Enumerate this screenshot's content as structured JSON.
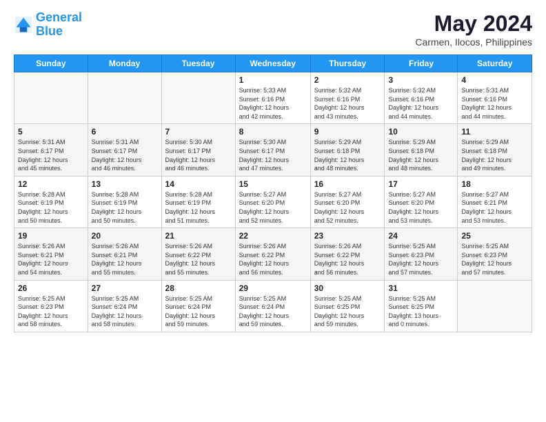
{
  "logo": {
    "line1": "General",
    "line2": "Blue"
  },
  "title": "May 2024",
  "subtitle": "Carmen, Ilocos, Philippines",
  "days_header": [
    "Sunday",
    "Monday",
    "Tuesday",
    "Wednesday",
    "Thursday",
    "Friday",
    "Saturday"
  ],
  "weeks": [
    [
      {
        "day": "",
        "info": ""
      },
      {
        "day": "",
        "info": ""
      },
      {
        "day": "",
        "info": ""
      },
      {
        "day": "1",
        "info": "Sunrise: 5:33 AM\nSunset: 6:16 PM\nDaylight: 12 hours\nand 42 minutes."
      },
      {
        "day": "2",
        "info": "Sunrise: 5:32 AM\nSunset: 6:16 PM\nDaylight: 12 hours\nand 43 minutes."
      },
      {
        "day": "3",
        "info": "Sunrise: 5:32 AM\nSunset: 6:16 PM\nDaylight: 12 hours\nand 44 minutes."
      },
      {
        "day": "4",
        "info": "Sunrise: 5:31 AM\nSunset: 6:16 PM\nDaylight: 12 hours\nand 44 minutes."
      }
    ],
    [
      {
        "day": "5",
        "info": "Sunrise: 5:31 AM\nSunset: 6:17 PM\nDaylight: 12 hours\nand 45 minutes."
      },
      {
        "day": "6",
        "info": "Sunrise: 5:31 AM\nSunset: 6:17 PM\nDaylight: 12 hours\nand 46 minutes."
      },
      {
        "day": "7",
        "info": "Sunrise: 5:30 AM\nSunset: 6:17 PM\nDaylight: 12 hours\nand 46 minutes."
      },
      {
        "day": "8",
        "info": "Sunrise: 5:30 AM\nSunset: 6:17 PM\nDaylight: 12 hours\nand 47 minutes."
      },
      {
        "day": "9",
        "info": "Sunrise: 5:29 AM\nSunset: 6:18 PM\nDaylight: 12 hours\nand 48 minutes."
      },
      {
        "day": "10",
        "info": "Sunrise: 5:29 AM\nSunset: 6:18 PM\nDaylight: 12 hours\nand 48 minutes."
      },
      {
        "day": "11",
        "info": "Sunrise: 5:29 AM\nSunset: 6:18 PM\nDaylight: 12 hours\nand 49 minutes."
      }
    ],
    [
      {
        "day": "12",
        "info": "Sunrise: 5:28 AM\nSunset: 6:19 PM\nDaylight: 12 hours\nand 50 minutes."
      },
      {
        "day": "13",
        "info": "Sunrise: 5:28 AM\nSunset: 6:19 PM\nDaylight: 12 hours\nand 50 minutes."
      },
      {
        "day": "14",
        "info": "Sunrise: 5:28 AM\nSunset: 6:19 PM\nDaylight: 12 hours\nand 51 minutes."
      },
      {
        "day": "15",
        "info": "Sunrise: 5:27 AM\nSunset: 6:20 PM\nDaylight: 12 hours\nand 52 minutes."
      },
      {
        "day": "16",
        "info": "Sunrise: 5:27 AM\nSunset: 6:20 PM\nDaylight: 12 hours\nand 52 minutes."
      },
      {
        "day": "17",
        "info": "Sunrise: 5:27 AM\nSunset: 6:20 PM\nDaylight: 12 hours\nand 53 minutes."
      },
      {
        "day": "18",
        "info": "Sunrise: 5:27 AM\nSunset: 6:21 PM\nDaylight: 12 hours\nand 53 minutes."
      }
    ],
    [
      {
        "day": "19",
        "info": "Sunrise: 5:26 AM\nSunset: 6:21 PM\nDaylight: 12 hours\nand 54 minutes."
      },
      {
        "day": "20",
        "info": "Sunrise: 5:26 AM\nSunset: 6:21 PM\nDaylight: 12 hours\nand 55 minutes."
      },
      {
        "day": "21",
        "info": "Sunrise: 5:26 AM\nSunset: 6:22 PM\nDaylight: 12 hours\nand 55 minutes."
      },
      {
        "day": "22",
        "info": "Sunrise: 5:26 AM\nSunset: 6:22 PM\nDaylight: 12 hours\nand 56 minutes."
      },
      {
        "day": "23",
        "info": "Sunrise: 5:26 AM\nSunset: 6:22 PM\nDaylight: 12 hours\nand 56 minutes."
      },
      {
        "day": "24",
        "info": "Sunrise: 5:25 AM\nSunset: 6:23 PM\nDaylight: 12 hours\nand 57 minutes."
      },
      {
        "day": "25",
        "info": "Sunrise: 5:25 AM\nSunset: 6:23 PM\nDaylight: 12 hours\nand 57 minutes."
      }
    ],
    [
      {
        "day": "26",
        "info": "Sunrise: 5:25 AM\nSunset: 6:23 PM\nDaylight: 12 hours\nand 58 minutes."
      },
      {
        "day": "27",
        "info": "Sunrise: 5:25 AM\nSunset: 6:24 PM\nDaylight: 12 hours\nand 58 minutes."
      },
      {
        "day": "28",
        "info": "Sunrise: 5:25 AM\nSunset: 6:24 PM\nDaylight: 12 hours\nand 59 minutes."
      },
      {
        "day": "29",
        "info": "Sunrise: 5:25 AM\nSunset: 6:24 PM\nDaylight: 12 hours\nand 59 minutes."
      },
      {
        "day": "30",
        "info": "Sunrise: 5:25 AM\nSunset: 6:25 PM\nDaylight: 12 hours\nand 59 minutes."
      },
      {
        "day": "31",
        "info": "Sunrise: 5:25 AM\nSunset: 6:25 PM\nDaylight: 13 hours\nand 0 minutes."
      },
      {
        "day": "",
        "info": ""
      }
    ]
  ]
}
